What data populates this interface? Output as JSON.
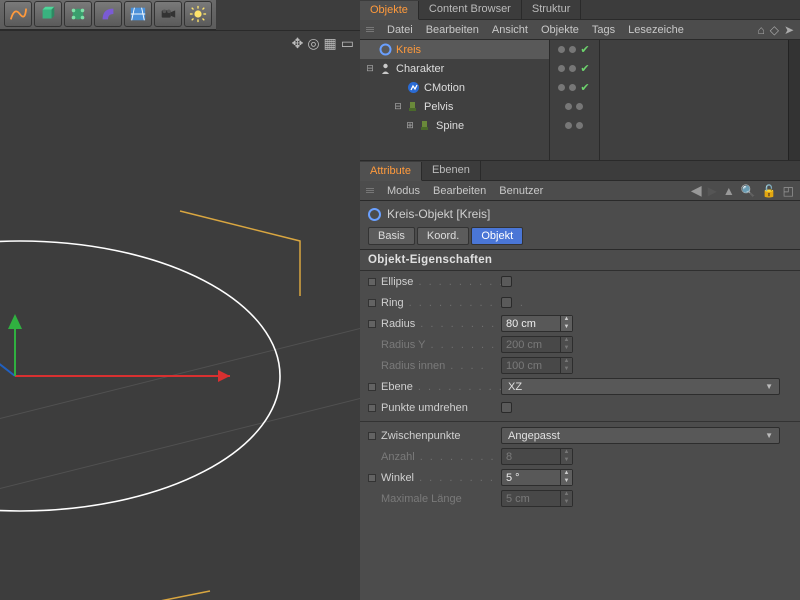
{
  "toolbar": {
    "tools": [
      "spline",
      "cube",
      "deformer",
      "bend",
      "floor",
      "camera",
      "light"
    ]
  },
  "object_manager": {
    "tabs": [
      "Objekte",
      "Content Browser",
      "Struktur"
    ],
    "active_tab": 0,
    "menu": [
      "Datei",
      "Bearbeiten",
      "Ansicht",
      "Objekte",
      "Tags",
      "Lesezeiche"
    ],
    "items": [
      {
        "name": "Kreis",
        "level": 0,
        "icon": "circle",
        "selected": true,
        "expander": "collapsed",
        "check": true
      },
      {
        "name": "Charakter",
        "level": 1,
        "icon": "character",
        "selected": false,
        "expander": "expanded",
        "check": true
      },
      {
        "name": "CMotion",
        "level": 2,
        "icon": "cmotion",
        "selected": false,
        "expander": "none",
        "check": true
      },
      {
        "name": "Pelvis",
        "level": 2,
        "icon": "joint",
        "selected": false,
        "expander": "expanded",
        "check": false
      },
      {
        "name": "Spine",
        "level": 3,
        "icon": "joint",
        "selected": false,
        "expander": "collapsed",
        "check": false
      }
    ]
  },
  "attribute_manager": {
    "panel_tabs": [
      "Attribute",
      "Ebenen"
    ],
    "panel_active": 0,
    "menu": [
      "Modus",
      "Bearbeiten",
      "Benutzer"
    ],
    "object_title": "Kreis-Objekt [Kreis]",
    "attr_tabs": [
      "Basis",
      "Koord.",
      "Objekt"
    ],
    "attr_active": 2,
    "section": "Objekt-Eigenschaften",
    "props": {
      "ellipse_label": "Ellipse",
      "ring_label": "Ring",
      "radius_label": "Radius",
      "radius_value": "80 cm",
      "radiusY_label": "Radius Y",
      "radiusY_value": "200 cm",
      "radiusInner_label": "Radius innen",
      "radiusInner_value": "100 cm",
      "ebene_label": "Ebene",
      "ebene_value": "XZ",
      "flip_label": "Punkte umdrehen",
      "zpunkte_label": "Zwischenpunkte",
      "zpunkte_value": "Angepasst",
      "anzahl_label": "Anzahl",
      "anzahl_value": "8",
      "winkel_label": "Winkel",
      "winkel_value": "5 °",
      "maxlen_label": "Maximale Länge",
      "maxlen_value": "5 cm"
    }
  }
}
